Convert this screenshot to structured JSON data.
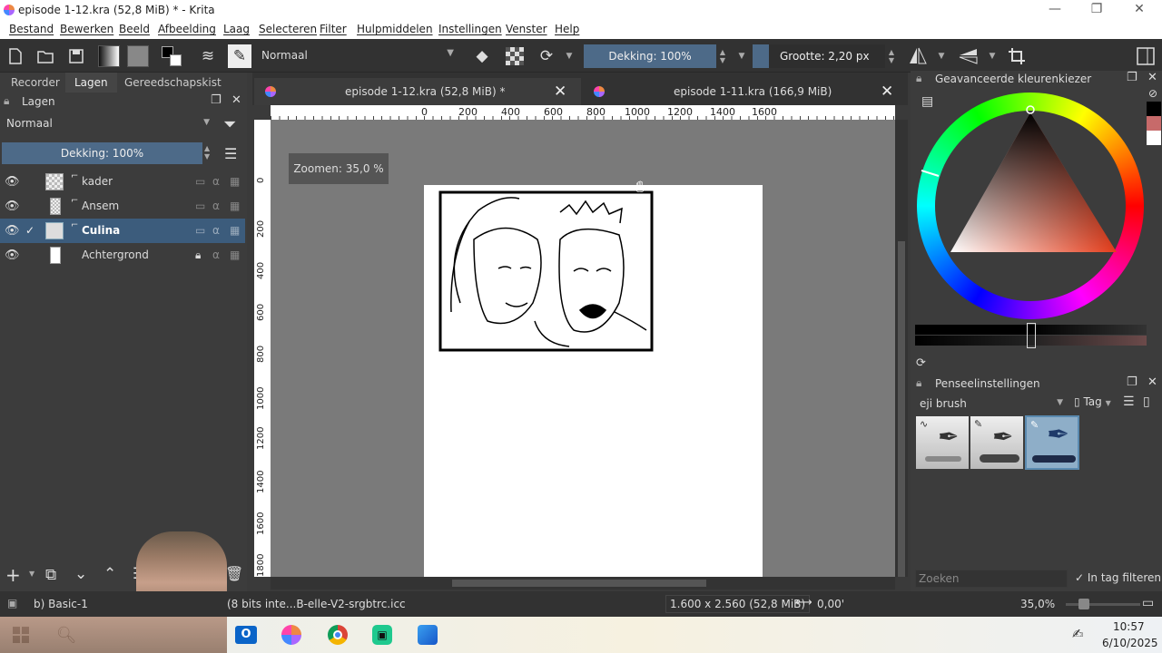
{
  "window": {
    "title": "episode 1-12.kra (52,8 MiB) * - Krita",
    "controls": {
      "minimize": "—",
      "maximize": "❐",
      "close": "✕"
    }
  },
  "menu": [
    "Bestand",
    "Bewerken",
    "Beeld",
    "Afbeelding",
    "Laag",
    "Selecteren",
    "Filter",
    "Hulpmiddelen",
    "Instellingen",
    "Venster",
    "Help"
  ],
  "toolbar": {
    "blend_mode": "Normaal",
    "opacity_label": "Dekking: 100%",
    "size_label": "Grootte: 2,20 px",
    "icons": [
      "new-document-icon",
      "open-document-icon",
      "save-icon",
      "gradient-icon",
      "pattern-icon",
      "color-swatch-icon",
      "brush-settings-icon",
      "brush-preset-icon",
      "eraser-icon",
      "alpha-lock-icon",
      "reload-icon",
      "mirror-horizontal-icon",
      "mirror-vertical-icon",
      "wrap-icon",
      "workspace-icon"
    ]
  },
  "left_dock": {
    "tabs": [
      "Recorder",
      "Lagen",
      "Gereedschapskist"
    ],
    "active_tab": "Lagen",
    "panel_title": "Lagen",
    "blend_mode": "Normaal",
    "opacity_label": "Dekking:  100%",
    "layers": [
      {
        "name": "kader",
        "checked": false,
        "selected": false
      },
      {
        "name": "Ansem",
        "checked": false,
        "selected": false
      },
      {
        "name": "Culina",
        "checked": true,
        "selected": true
      },
      {
        "name": "Achtergrond",
        "checked": false,
        "selected": false
      }
    ]
  },
  "canvas": {
    "tabs": [
      {
        "label": "episode 1-12.kra (52,8 MiB) *",
        "active": true
      },
      {
        "label": "episode 1-11.kra (166,9 MiB)",
        "active": false
      }
    ],
    "zoom_popup": "Zoomen: 35,0 %",
    "ruler_h": [
      "0",
      "200",
      "400",
      "600",
      "800",
      "1000",
      "1200",
      "1400",
      "1600"
    ],
    "ruler_v": [
      "0",
      "200",
      "400",
      "600",
      "800",
      "1000",
      "1200",
      "1400",
      "1600",
      "1800"
    ],
    "bg_color": "#7a7a7a"
  },
  "right_dock": {
    "color_panel_title": "Geavanceerde kleurenkiezer",
    "brush_panel_title": "Penseelinstellingen",
    "brush_preset": "eji brush",
    "tag_label": "Tag",
    "search_placeholder": "Zoeken",
    "tag_filter_label": "In tag filteren",
    "tag_filter_checked": true,
    "fg_color": "#000000",
    "bg_color": "#ffffff"
  },
  "status": {
    "brush_name": "b) Basic-1",
    "color_profile": "(8 bits inte...B-elle-V2-srgbtrc.icc",
    "dimensions": "1.600 x 2.560 (52,8 MiB)",
    "rotation": "0,00'",
    "zoom": "35,0%"
  },
  "taskbar": {
    "time": "10:57",
    "date": "6/10/2025"
  }
}
